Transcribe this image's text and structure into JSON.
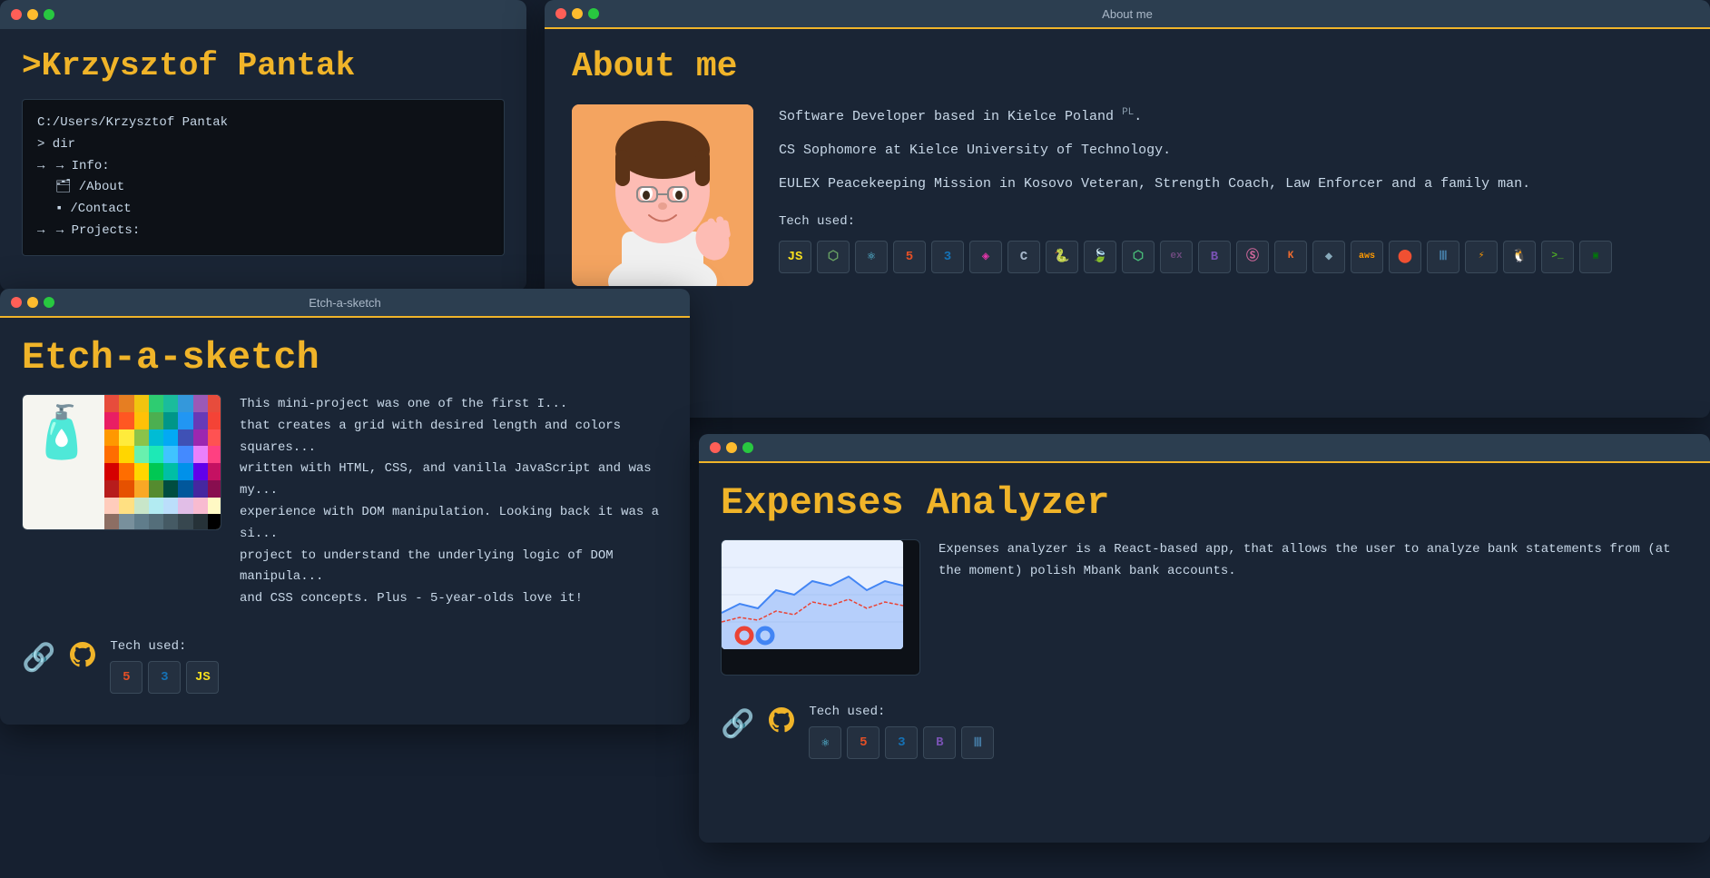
{
  "app": {
    "background": "#162030"
  },
  "main_window": {
    "title": "",
    "site_title": ">Krzysztof Pantak",
    "terminal": {
      "path": "C:/Users/Krzysztof Pantak",
      "command": "> dir",
      "info_label": "→ Info:",
      "about_link": "/About",
      "contact_link": "/Contact",
      "projects_label": "→ Projects:",
      "folder_icon": "📁",
      "file_icon": "📄"
    }
  },
  "about_window": {
    "title": "About me",
    "heading": "About me",
    "description_1": "Software Developer based in Kielce Poland",
    "pl_text": "PL",
    "description_2": "CS Sophomore at Kielce University of Technology.",
    "description_3": "EULEX Peacekeeping Mission in Kosovo Veteran, Strength Coach, Law Enforcer and a family man.",
    "tech_label": "Tech used:",
    "tech_icons": [
      "JS",
      "Node",
      "React",
      "HTML5",
      "CSS3",
      "GraphQL",
      "C",
      "Python",
      "Mongo",
      "Feather",
      "Ex",
      "Bootstrap",
      "Sass",
      "Klipfolio",
      "AWS",
      "Git",
      "DB",
      "Amplify",
      "Linux",
      "Bash",
      "FFmpeg"
    ]
  },
  "etch_window": {
    "title": "Etch-a-sketch",
    "heading": "Etch-a-sketch",
    "description": "This mini-project was one of the first I ... that creates a grid with desired length and colors squares... written with HTML, CSS, and vanilla JavaScript and was my... experience with DOM manipulation. Looking back it was a si... project to understand the underlying logic of DOM manipula... and CSS concepts. Plus - 5-year-olds love it!",
    "tech_label": "Tech used:",
    "tech_icons": [
      "HTML5",
      "CSS3",
      "JS"
    ],
    "link_icon": "🔗",
    "github_icon": "⊙"
  },
  "expenses_window": {
    "title": "",
    "heading": "Expenses Analyzer",
    "description": "Expenses analyzer is a React-based app, that allows the user to analyze bank statements from (at the moment) polish Mbank bank accounts.",
    "tech_label": "Tech used:",
    "tech_icons": [
      "React",
      "HTML5",
      "CSS3",
      "Bootstrap",
      "DB"
    ],
    "link_icon": "🔗",
    "github_icon": "⊙"
  },
  "colors": {
    "accent": "#f0b429",
    "bg_dark": "#1a2535",
    "bg_darker": "#0d1117",
    "text_primary": "#c8d8e8",
    "window_border": "#f0b429"
  }
}
